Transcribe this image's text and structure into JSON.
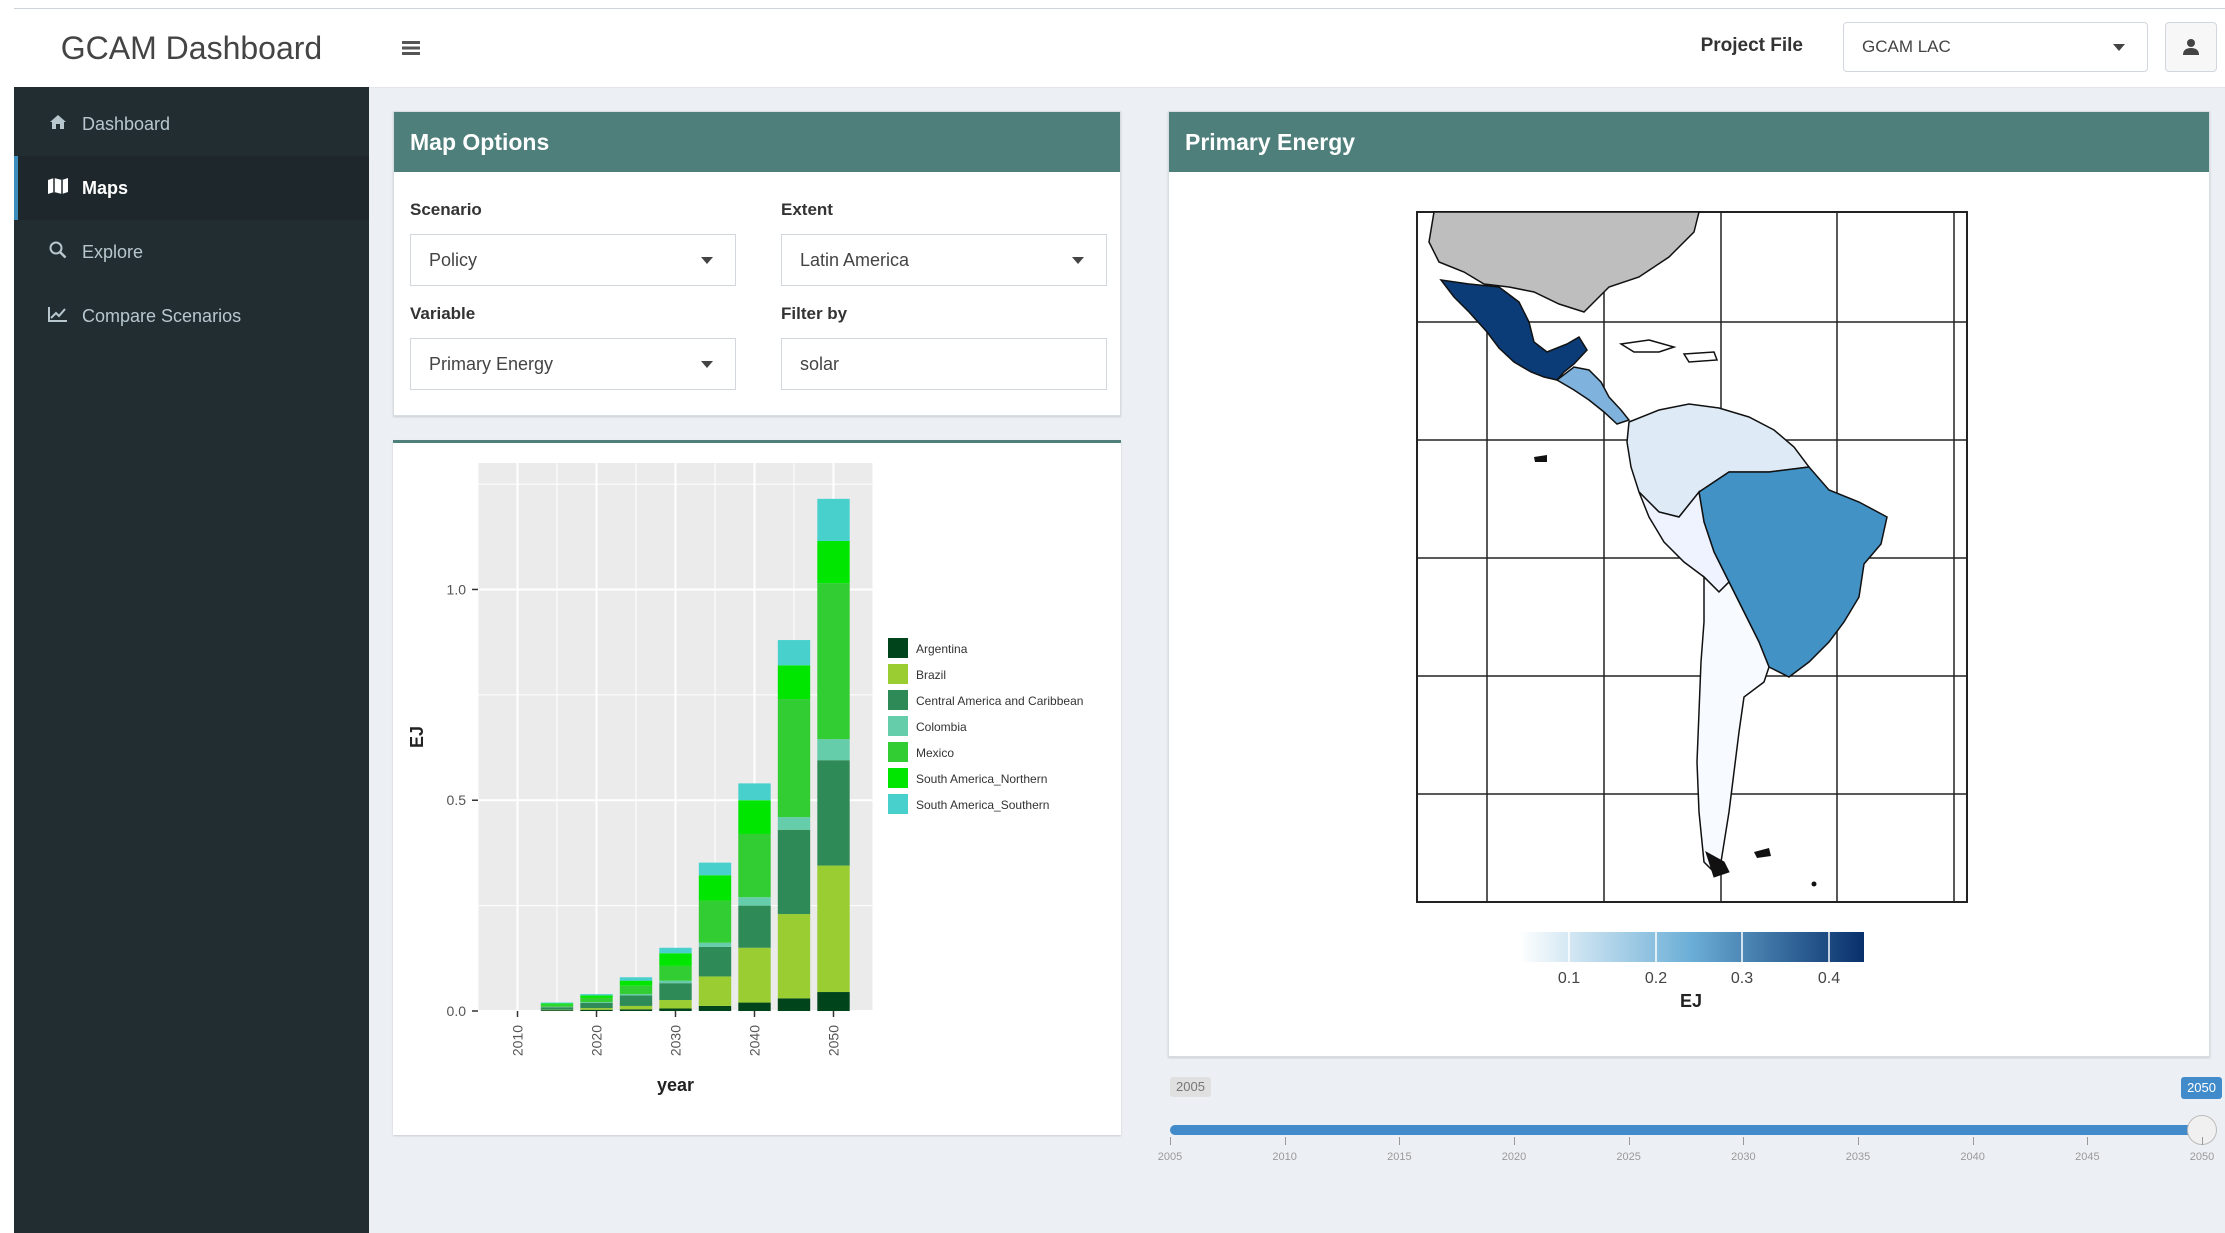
{
  "header": {
    "app_title": "GCAM Dashboard",
    "menu_icon": "hamburger-icon",
    "project_file_label": "Project File",
    "project_file_value": "GCAM LAC",
    "user_icon": "user-icon"
  },
  "sidebar": {
    "items": [
      {
        "label": "Dashboard",
        "icon": "dashboard-icon",
        "active": false
      },
      {
        "label": "Maps",
        "icon": "map-icon",
        "active": true
      },
      {
        "label": "Explore",
        "icon": "search-icon",
        "active": false
      },
      {
        "label": "Compare Scenarios",
        "icon": "chart-line-icon",
        "active": false
      }
    ]
  },
  "map_options": {
    "title": "Map Options",
    "scenario_label": "Scenario",
    "scenario_value": "Policy",
    "extent_label": "Extent",
    "extent_value": "Latin America",
    "variable_label": "Variable",
    "variable_value": "Primary Energy",
    "filter_label": "Filter by",
    "filter_value": "solar"
  },
  "primary_energy": {
    "title": "Primary Energy"
  },
  "map_legend": {
    "ticks": [
      "0.1",
      "0.2",
      "0.3",
      "0.4"
    ],
    "label": "EJ",
    "color_low": "#f7fbff",
    "color_high": "#08306b"
  },
  "chart_data": {
    "type": "bar",
    "stacked": true,
    "categories": [
      "2010",
      "2020",
      "2030",
      "2040",
      "2050"
    ],
    "x": [
      2010,
      2015,
      2020,
      2025,
      2030,
      2035,
      2040,
      2045,
      2050
    ],
    "xlabel": "year",
    "ylabel": "EJ",
    "ylim": [
      0,
      1.3
    ],
    "yticks": [
      0.0,
      0.5,
      1.0
    ],
    "ytick_labels": [
      "0.0",
      "0.5",
      "1.0"
    ],
    "grid": true,
    "legend_position": "right",
    "series": [
      {
        "name": "Argentina",
        "color": "#00441b",
        "values": [
          0,
          0.002,
          0.003,
          0.004,
          0.006,
          0.012,
          0.02,
          0.03,
          0.045
        ]
      },
      {
        "name": "Brazil",
        "color": "#9acd32",
        "values": [
          0,
          0.001,
          0.004,
          0.008,
          0.02,
          0.07,
          0.13,
          0.2,
          0.3
        ]
      },
      {
        "name": "Central America and Caribbean",
        "color": "#2e8b57",
        "values": [
          0,
          0.006,
          0.012,
          0.025,
          0.04,
          0.07,
          0.1,
          0.2,
          0.25
        ]
      },
      {
        "name": "Colombia",
        "color": "#66cdaa",
        "values": [
          0,
          0.001,
          0.002,
          0.003,
          0.006,
          0.01,
          0.02,
          0.03,
          0.05
        ]
      },
      {
        "name": "Mexico",
        "color": "#32cd32",
        "values": [
          0,
          0.005,
          0.01,
          0.02,
          0.035,
          0.1,
          0.15,
          0.28,
          0.37
        ]
      },
      {
        "name": "South America_Northern",
        "color": "#00e600",
        "values": [
          0,
          0.003,
          0.006,
          0.012,
          0.03,
          0.06,
          0.08,
          0.08,
          0.1
        ]
      },
      {
        "name": "South America_Southern",
        "color": "#48d1cc",
        "values": [
          0,
          0.002,
          0.003,
          0.008,
          0.013,
          0.03,
          0.04,
          0.06,
          0.1
        ]
      }
    ]
  },
  "time_slider": {
    "min_value": "2005",
    "max_value": "2050",
    "current_value": "2050",
    "fill_fraction": 1.0,
    "tick_labels": [
      "2005",
      "2010",
      "2015",
      "2020",
      "2025",
      "2030",
      "2035",
      "2040",
      "2045",
      "2050"
    ]
  }
}
